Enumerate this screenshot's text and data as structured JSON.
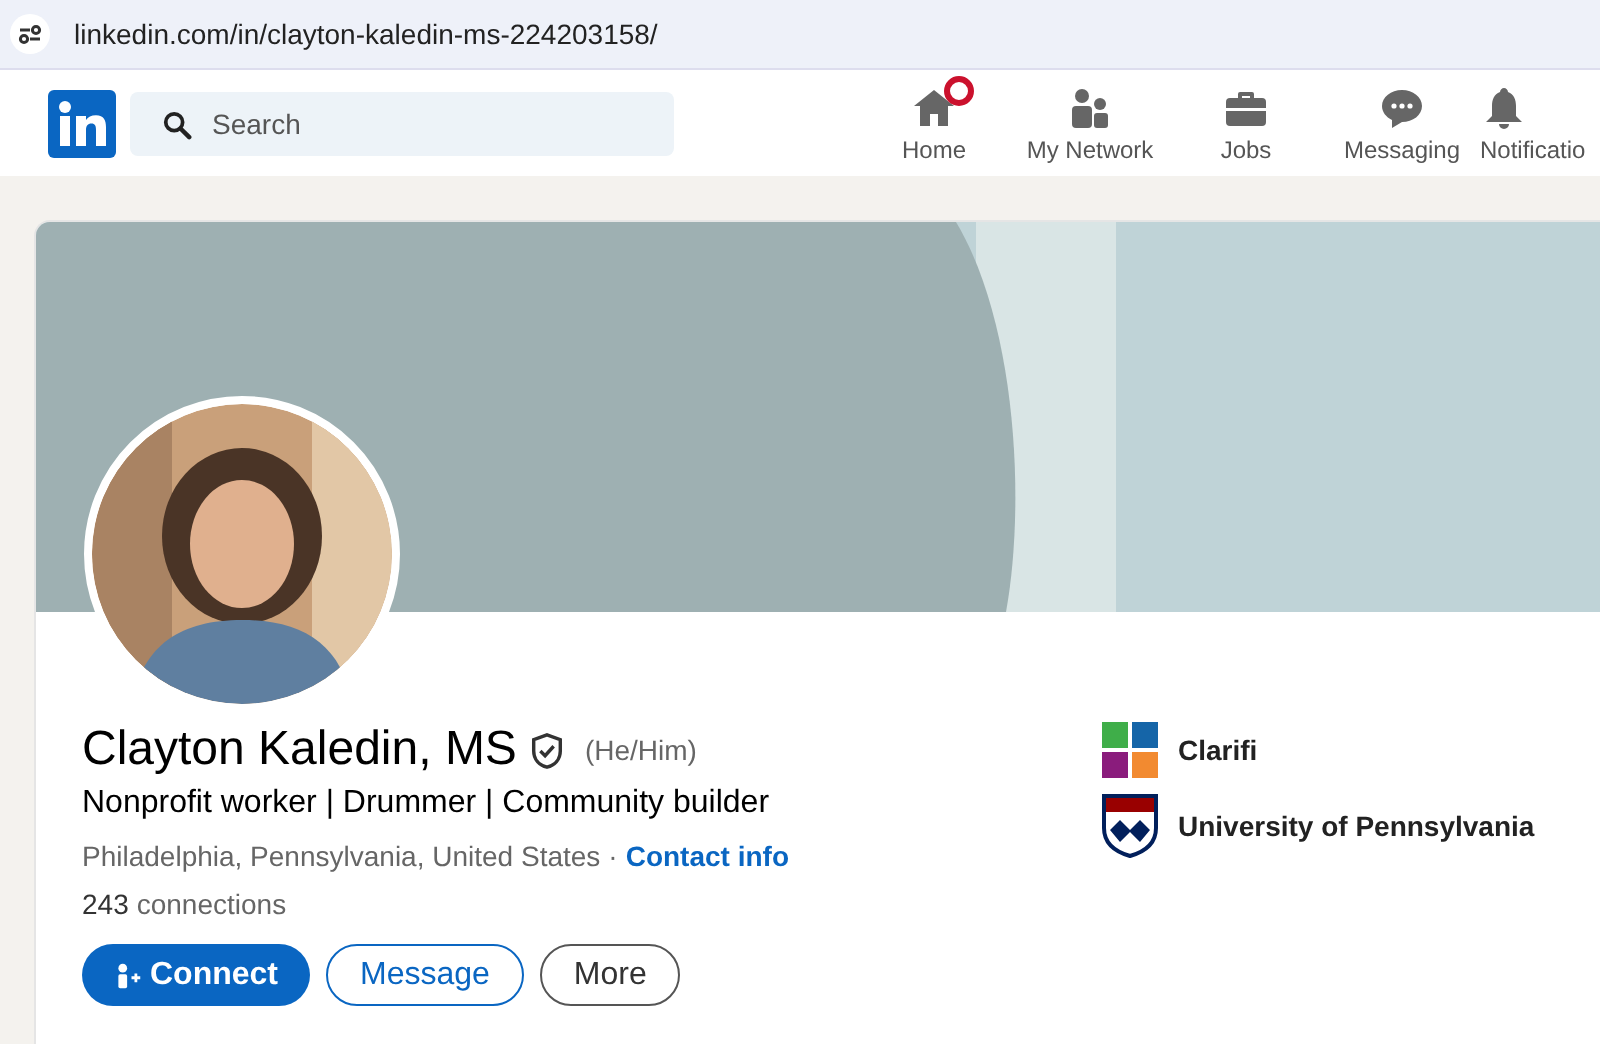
{
  "address_bar": {
    "url": "linkedin.com/in/clayton-kaledin-ms-224203158/"
  },
  "nav": {
    "search": {
      "placeholder": "Search"
    },
    "items": [
      {
        "label": "Home",
        "kind": "home",
        "notification": true
      },
      {
        "label": "My Network",
        "kind": "network",
        "notification": false
      },
      {
        "label": "Jobs",
        "kind": "jobs",
        "notification": false
      },
      {
        "label": "Messaging",
        "kind": "messaging",
        "notification": false
      },
      {
        "label": "Notificatio",
        "kind": "bell",
        "notification": false
      }
    ]
  },
  "profile": {
    "name": "Clayton Kaledin, MS",
    "verified": true,
    "pronouns": "(He/Him)",
    "headline": "Nonprofit worker | Drummer | Community builder",
    "location": "Philadelphia, Pennsylvania, United States",
    "separator": "·",
    "contact_link": "Contact info",
    "connections_count": "243",
    "connections_label": "connections",
    "buttons": [
      {
        "label": "Connect",
        "kind": "primary"
      },
      {
        "label": "Message",
        "kind": "secondary"
      },
      {
        "label": "More",
        "kind": "tertiary"
      }
    ],
    "affiliations": [
      {
        "name": "Clarifi",
        "kind": "company"
      },
      {
        "name": "University of Pennsylvania",
        "kind": "school"
      }
    ]
  }
}
